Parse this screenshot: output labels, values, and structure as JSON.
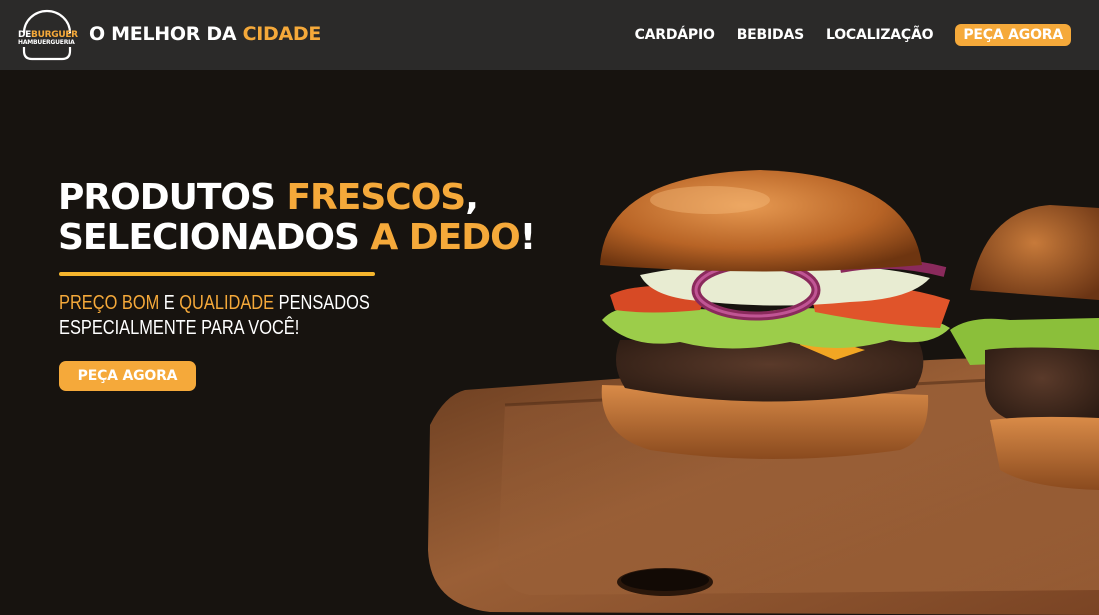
{
  "brand": {
    "logo_line1_a": "DE",
    "logo_line1_b": "BURGUER",
    "logo_line2": "HAMBUERGUERIA",
    "tagline_a": "O MELHOR DA ",
    "tagline_b": "CIDADE",
    "accent_color": "#f5a93a"
  },
  "nav": {
    "items": [
      {
        "label": "CARDÁPIO"
      },
      {
        "label": "BEBIDAS"
      },
      {
        "label": "LOCALIZAÇÃO"
      }
    ],
    "cta_label": "PEÇA AGORA"
  },
  "hero": {
    "title_1a": "PRODUTOS ",
    "title_1b": "FRESCOS",
    "title_1c": ",",
    "title_2a": "SELECIONADOS ",
    "title_2b": "A DEDO",
    "title_2c": "!",
    "subtitle_1a": "PREÇO BOM",
    "subtitle_1b": " E ",
    "subtitle_1c": "QUALIDADE",
    "subtitle_1d": " PENSADOS",
    "subtitle_2": "ESPECIALMENTE PARA VOCÊ!",
    "cta_label": "PEÇA AGORA",
    "image_icon": "burger-on-cutting-board-photo"
  }
}
